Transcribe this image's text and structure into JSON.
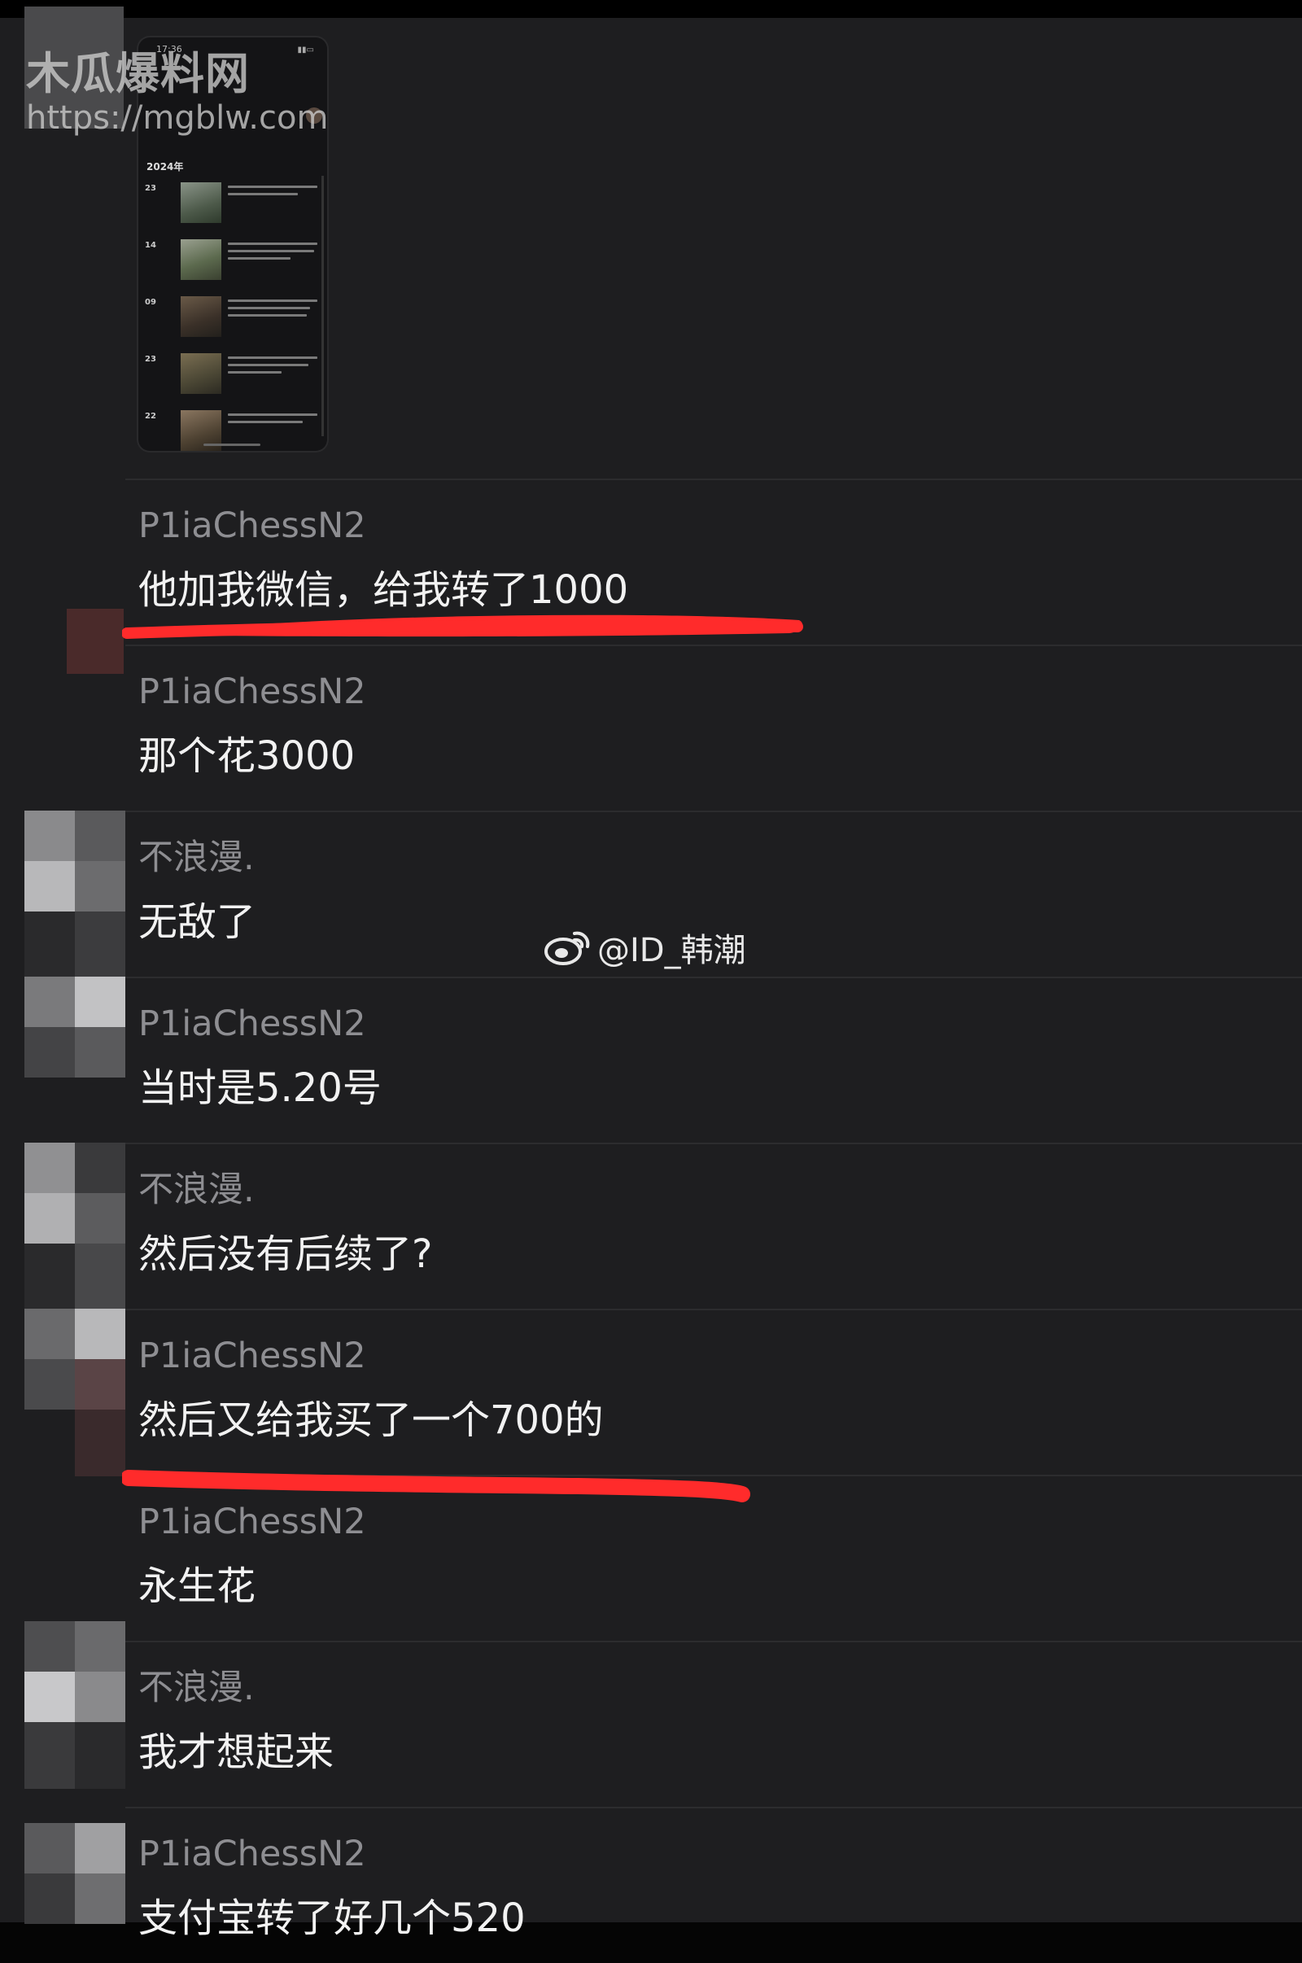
{
  "watermark": {
    "site_title": "木瓜爆料网",
    "site_url": "https://mgblw.com"
  },
  "weibo_watermark": {
    "icon": "weibo-icon",
    "handle": "@ID_韩潮"
  },
  "image_message": {
    "time": "17:36",
    "year": "2024年",
    "dates": [
      "23",
      "14",
      "09",
      "23",
      "22"
    ]
  },
  "messages": [
    {
      "sender": "P1iaChessN2",
      "text": "他加我微信，给我转了1000",
      "highlighted": true
    },
    {
      "sender": "P1iaChessN2",
      "text": "那个花3000",
      "highlighted": false
    },
    {
      "sender": "不浪漫.",
      "text": "无敌了",
      "highlighted": false
    },
    {
      "sender": "P1iaChessN2",
      "text": "当时是5.20号",
      "highlighted": false
    },
    {
      "sender": "不浪漫.",
      "text": "然后没有后续了?",
      "highlighted": false
    },
    {
      "sender": "P1iaChessN2",
      "text": "然后又给我买了一个700的",
      "highlighted": true
    },
    {
      "sender": "P1iaChessN2",
      "text": "永生花",
      "highlighted": false
    },
    {
      "sender": "不浪漫.",
      "text": "我才想起来",
      "highlighted": false
    },
    {
      "sender": "P1iaChessN2",
      "text": "支付宝转了好几个520",
      "highlighted": false
    }
  ],
  "colors": {
    "background": "#1e1e20",
    "sender_text": "#8e8e92",
    "message_text": "#f2f2f2",
    "underline": "#ff2b2b"
  }
}
